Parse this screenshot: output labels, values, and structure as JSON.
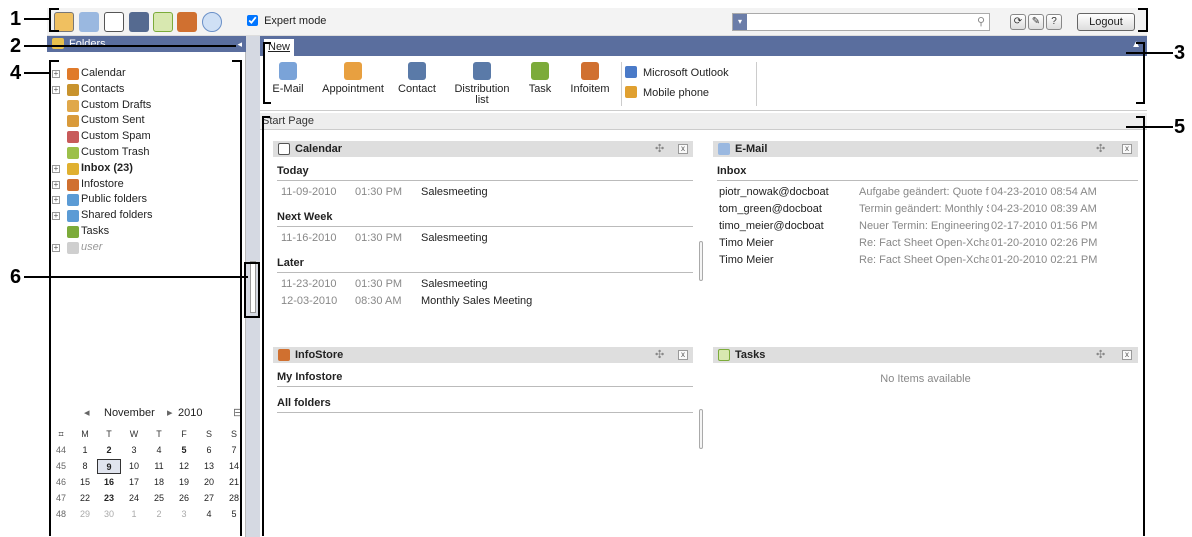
{
  "callouts": [
    "1",
    "2",
    "3",
    "4",
    "5",
    "6"
  ],
  "toolbar": {
    "icons": [
      "home-icon",
      "email-icon",
      "calendar-icon",
      "contacts-icon",
      "tasks-icon",
      "infostore-icon",
      "settings-icon"
    ],
    "expert_mode_label": "Expert mode",
    "expert_mode_checked": true,
    "search_placeholder": "",
    "refresh_label": "⟳",
    "tools_label": "✎",
    "help_label": "?",
    "logout_label": "Logout"
  },
  "folders": {
    "title": "Folders",
    "collapse_glyph": "◂",
    "items": [
      {
        "label": "Calendar",
        "expandable": true,
        "icon": "calendar-icon",
        "color": "#e07a2a",
        "style": "normal"
      },
      {
        "label": "Contacts",
        "expandable": true,
        "icon": "contacts-icon",
        "color": "#c8932e",
        "style": "normal"
      },
      {
        "label": "Custom Drafts",
        "expandable": false,
        "icon": "drafts-icon",
        "color": "#e0a84a",
        "style": "normal"
      },
      {
        "label": "Custom Sent",
        "expandable": false,
        "icon": "sent-icon",
        "color": "#d99a3a",
        "style": "normal"
      },
      {
        "label": "Custom Spam",
        "expandable": false,
        "icon": "spam-icon",
        "color": "#c85a5a",
        "style": "normal"
      },
      {
        "label": "Custom Trash",
        "expandable": false,
        "icon": "trash-icon",
        "color": "#9cc04a",
        "style": "normal"
      },
      {
        "label": "Inbox (23)",
        "expandable": true,
        "icon": "inbox-icon",
        "color": "#e0b030",
        "style": "bold"
      },
      {
        "label": "Infostore",
        "expandable": true,
        "icon": "infostore-icon",
        "color": "#d07030",
        "style": "normal"
      },
      {
        "label": "Public folders",
        "expandable": true,
        "icon": "public-folders-icon",
        "color": "#5b9bd5",
        "style": "normal"
      },
      {
        "label": "Shared folders",
        "expandable": true,
        "icon": "shared-folders-icon",
        "color": "#5b9bd5",
        "style": "normal"
      },
      {
        "label": "Tasks",
        "expandable": false,
        "icon": "tasks-icon",
        "color": "#7cab3a",
        "style": "normal"
      },
      {
        "label": "user",
        "expandable": true,
        "icon": "user-folder-icon",
        "color": "#cfcfcf",
        "style": "italic"
      }
    ]
  },
  "minicalendar": {
    "prev": "◂",
    "month": "November",
    "next": "▸",
    "year": "2010",
    "collapse": "⊟",
    "week_icon": "week-icon",
    "dow": [
      "M",
      "T",
      "W",
      "T",
      "F",
      "S",
      "S"
    ],
    "weeks": [
      {
        "wk": "44",
        "days": [
          "1",
          "2",
          "3",
          "4",
          "5",
          "6",
          "7"
        ],
        "bold": [
          "2",
          "5"
        ],
        "other": []
      },
      {
        "wk": "45",
        "days": [
          "8",
          "9",
          "10",
          "11",
          "12",
          "13",
          "14"
        ],
        "bold": [],
        "other": []
      },
      {
        "wk": "46",
        "days": [
          "15",
          "16",
          "17",
          "18",
          "19",
          "20",
          "21"
        ],
        "bold": [
          "16"
        ],
        "other": []
      },
      {
        "wk": "47",
        "days": [
          "22",
          "23",
          "24",
          "25",
          "26",
          "27",
          "28"
        ],
        "bold": [
          "23"
        ],
        "other": []
      },
      {
        "wk": "48",
        "days": [
          "29",
          "30",
          "1",
          "2",
          "3",
          "4",
          "5"
        ],
        "bold": [
          "30"
        ],
        "other": [
          2,
          3,
          4,
          5,
          6
        ]
      }
    ],
    "today": "9"
  },
  "main": {
    "tab_label": "New",
    "collapse_glyph": "▲",
    "ribbon": [
      {
        "label": "E-Mail",
        "icon": "email-icon",
        "color": "#7aa3d8"
      },
      {
        "label": "Appointment",
        "icon": "appointment-icon",
        "color": "#e8a040"
      },
      {
        "label": "Contact",
        "icon": "contact-icon",
        "color": "#5a7aa8"
      },
      {
        "label": "Distribution\nlist",
        "icon": "distribution-list-icon",
        "color": "#5a7aa8"
      },
      {
        "label": "Task",
        "icon": "task-icon",
        "color": "#7cab3a"
      },
      {
        "label": "Infoitem",
        "icon": "infoitem-icon",
        "color": "#d07030"
      }
    ],
    "links": [
      {
        "label": "Microsoft Outlook",
        "icon": "outlook-icon",
        "color": "#4a7ac8"
      },
      {
        "label": "Mobile phone",
        "icon": "mobile-phone-icon",
        "color": "#e0a030"
      }
    ],
    "start_page_label": "Start Page"
  },
  "widgets": {
    "calendar": {
      "title": "Calendar",
      "sections": [
        {
          "name": "Today",
          "events": [
            {
              "date": "11-09-2010",
              "time": "01:30 PM",
              "title": "Salesmeeting"
            }
          ]
        },
        {
          "name": "Next Week",
          "events": [
            {
              "date": "11-16-2010",
              "time": "01:30 PM",
              "title": "Salesmeeting"
            }
          ]
        },
        {
          "name": "Later",
          "events": [
            {
              "date": "11-23-2010",
              "time": "01:30 PM",
              "title": "Salesmeeting"
            },
            {
              "date": "12-03-2010",
              "time": "08:30 AM",
              "title": "Monthly Sales Meeting"
            }
          ]
        }
      ]
    },
    "email": {
      "title": "E-Mail",
      "section": "Inbox",
      "rows": [
        {
          "from": "piotr_nowak@docboat",
          "subject": "Aufgabe geändert: Quote for '",
          "date": "04-23-2010 08:54 AM"
        },
        {
          "from": "tom_green@docboat",
          "subject": "Termin geändert: Monthly Sa",
          "date": "04-23-2010 08:39 AM"
        },
        {
          "from": "timo_meier@docboat",
          "subject": "Neuer Termin: Engineering te",
          "date": "02-17-2010 01:56 PM"
        },
        {
          "from": "Timo Meier",
          "subject": "Re: Fact Sheet Open-Xchang",
          "date": "01-20-2010 02:26 PM"
        },
        {
          "from": "Timo Meier",
          "subject": "Re: Fact Sheet Open-Xchang",
          "date": "01-20-2010 02:21 PM"
        }
      ]
    },
    "infostore": {
      "title": "InfoStore",
      "sections": [
        "My Infostore",
        "All folders"
      ]
    },
    "tasks": {
      "title": "Tasks",
      "empty_label": "No Items available"
    },
    "move_glyph": "✣",
    "close_glyph": "x"
  }
}
